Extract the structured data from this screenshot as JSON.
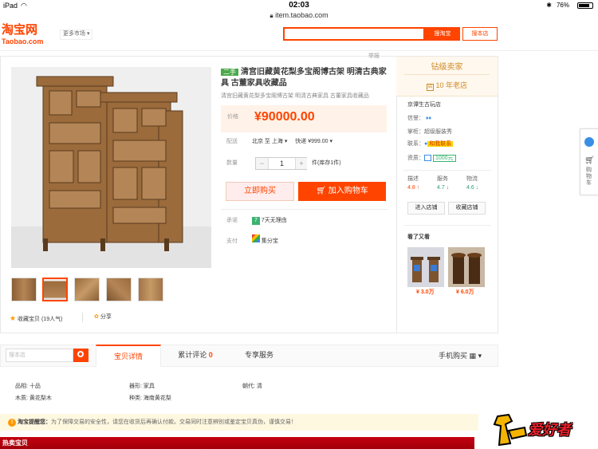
{
  "status_bar": {
    "device": "iPad",
    "time": "02:03",
    "battery": "76%"
  },
  "url": "item.taobao.com",
  "header": {
    "logo_cn": "淘宝网",
    "logo_en": "Taobao.com",
    "market_link": "更多市场",
    "search_value": "",
    "search_taobao_btn": "搜淘宝",
    "search_shop_btn": "搜本店"
  },
  "product": {
    "report": "举报",
    "tag": "二手",
    "title": "清宫旧藏黄花梨多宝阁博古架 明清古典家具 古董家具收藏品",
    "subtitle": "清宫旧藏黄花梨多宝阁博古架 明清古典家具 古董家具收藏品",
    "price_label": "价格",
    "price": "¥90000.00",
    "shipping_label": "配送",
    "shipping_from": "北京 至",
    "shipping_to": "上海",
    "shipping_express": "快递 ¥999.00",
    "qty_label": "数量",
    "qty_value": "1",
    "stock": "件(库存1件)",
    "buy_now": "立即购买",
    "add_to_cart": "加入购物车",
    "promise_label": "承诺",
    "promise_value": "7天无理由",
    "pay_label": "支付",
    "pay_value": "集分宝",
    "fav_label": "收藏宝贝 (19人气)",
    "share_label": "分享"
  },
  "shop": {
    "level": "钻级卖家",
    "years": "10 年老店",
    "name": "京谭生古玩店",
    "credit_label": "信誉：",
    "seller_label": "掌柜：",
    "seller_value": "超级服装秀",
    "contact_label": "联系：",
    "contact_value": "和我联系",
    "quals_label": "资质：",
    "quals_value": "1000元",
    "scores": [
      {
        "label": "描述",
        "value": "4.8",
        "trend": "up"
      },
      {
        "label": "服务",
        "value": "4.7",
        "trend": "down"
      },
      {
        "label": "物流",
        "value": "4.6",
        "trend": "down"
      }
    ],
    "enter_shop": "进入店铺",
    "fav_shop": "收藏店铺",
    "also_viewed": "看了又看",
    "related_prices": [
      "¥ 3.0万",
      "¥ 6.0万"
    ]
  },
  "side_toolbar": {
    "cart_label": "购物车"
  },
  "tabs": {
    "shop_search_placeholder": "搜本店",
    "items": [
      "宝贝详情",
      "累计评论",
      "专享服务"
    ],
    "review_count": "0",
    "mobile": "手机购买"
  },
  "attributes": [
    {
      "label": "品相:",
      "value": "十品"
    },
    {
      "label": "器形:",
      "value": "家具"
    },
    {
      "label": "朝代:",
      "value": "清"
    },
    {
      "label": "木质:",
      "value": "黄花梨木"
    },
    {
      "label": "种类:",
      "value": "海南黄花梨"
    }
  ],
  "notice": {
    "title": "淘宝提醒您：",
    "text": "为了保障交易的安全性，请您在收货后再确认付款。交易同时注意辨别或鉴定宝贝真伪，谨慎交易！"
  },
  "hot_items": "热卖宝贝",
  "watermark": "爱好者",
  "colors": {
    "accent": "#ff4400",
    "price": "#ff4400",
    "diamond": "#d08a28",
    "hot": "#c40010"
  }
}
